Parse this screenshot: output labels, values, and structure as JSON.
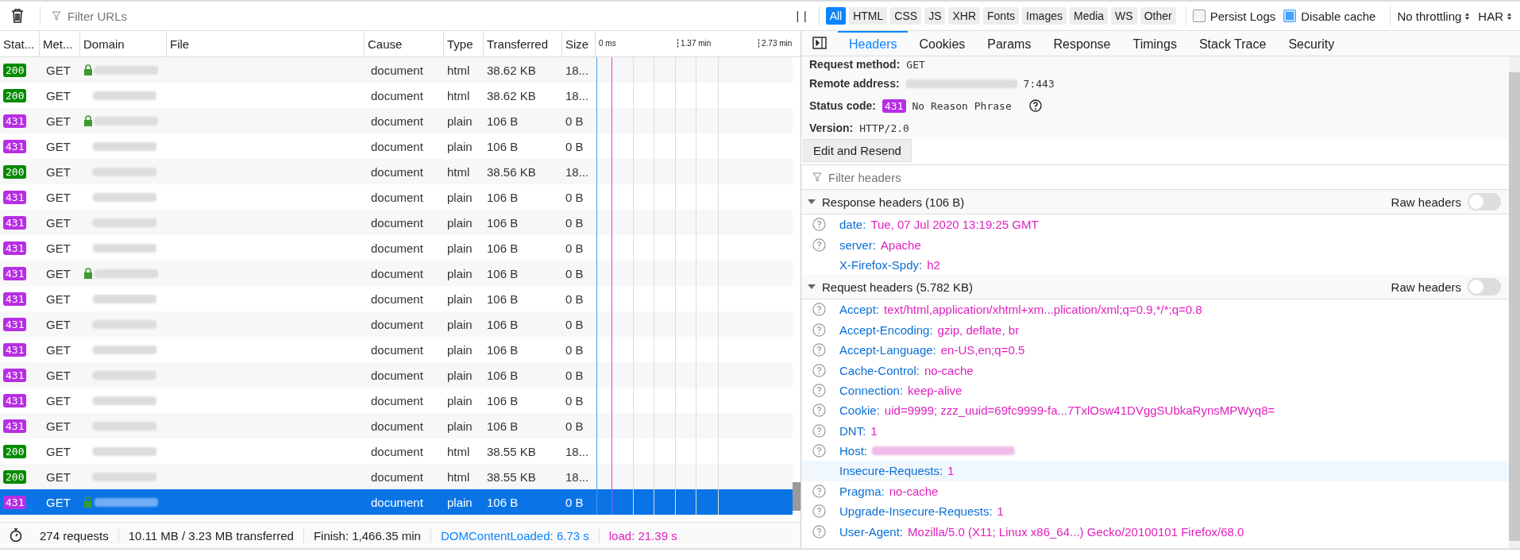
{
  "toolbar": {
    "filter_placeholder": "Filter URLs",
    "pause_icon": "| |",
    "type_filters": [
      {
        "label": "All",
        "selected": true
      },
      {
        "label": "HTML",
        "selected": false
      },
      {
        "label": "CSS",
        "selected": false
      },
      {
        "label": "JS",
        "selected": false
      },
      {
        "label": "XHR",
        "selected": false
      },
      {
        "label": "Fonts",
        "selected": false
      },
      {
        "label": "Images",
        "selected": false
      },
      {
        "label": "Media",
        "selected": false
      },
      {
        "label": "WS",
        "selected": false
      },
      {
        "label": "Other",
        "selected": false
      }
    ],
    "options": [
      {
        "label": "Persist Logs",
        "checked": false
      },
      {
        "label": "Disable cache",
        "checked": true
      }
    ],
    "throttling": "No throttling",
    "har": "HAR"
  },
  "requests": {
    "columns": [
      "Stat...",
      "Met...",
      "Domain",
      "File",
      "Cause",
      "Type",
      "Transferred",
      "Size"
    ],
    "timeline_ticks": [
      "0 ms",
      "1.37 min",
      "2.73 min"
    ],
    "rows": [
      {
        "status": "200",
        "method": "GET",
        "secure": true,
        "cause": "document",
        "type": "html",
        "transferred": "38.62 KB",
        "size": "18...",
        "selected": false
      },
      {
        "status": "200",
        "method": "GET",
        "secure": false,
        "cause": "document",
        "type": "html",
        "transferred": "38.62 KB",
        "size": "18...",
        "selected": false
      },
      {
        "status": "431",
        "method": "GET",
        "secure": true,
        "cause": "document",
        "type": "plain",
        "transferred": "106 B",
        "size": "0 B",
        "selected": false
      },
      {
        "status": "431",
        "method": "GET",
        "secure": false,
        "cause": "document",
        "type": "plain",
        "transferred": "106 B",
        "size": "0 B",
        "selected": false
      },
      {
        "status": "200",
        "method": "GET",
        "secure": false,
        "cause": "document",
        "type": "html",
        "transferred": "38.56 KB",
        "size": "18...",
        "selected": false
      },
      {
        "status": "431",
        "method": "GET",
        "secure": false,
        "cause": "document",
        "type": "plain",
        "transferred": "106 B",
        "size": "0 B",
        "selected": false
      },
      {
        "status": "431",
        "method": "GET",
        "secure": false,
        "cause": "document",
        "type": "plain",
        "transferred": "106 B",
        "size": "0 B",
        "selected": false
      },
      {
        "status": "431",
        "method": "GET",
        "secure": false,
        "cause": "document",
        "type": "plain",
        "transferred": "106 B",
        "size": "0 B",
        "selected": false
      },
      {
        "status": "431",
        "method": "GET",
        "secure": true,
        "cause": "document",
        "type": "plain",
        "transferred": "106 B",
        "size": "0 B",
        "selected": false
      },
      {
        "status": "431",
        "method": "GET",
        "secure": false,
        "cause": "document",
        "type": "plain",
        "transferred": "106 B",
        "size": "0 B",
        "selected": false
      },
      {
        "status": "431",
        "method": "GET",
        "secure": false,
        "cause": "document",
        "type": "plain",
        "transferred": "106 B",
        "size": "0 B",
        "selected": false
      },
      {
        "status": "431",
        "method": "GET",
        "secure": false,
        "cause": "document",
        "type": "plain",
        "transferred": "106 B",
        "size": "0 B",
        "selected": false
      },
      {
        "status": "431",
        "method": "GET",
        "secure": false,
        "cause": "document",
        "type": "plain",
        "transferred": "106 B",
        "size": "0 B",
        "selected": false
      },
      {
        "status": "431",
        "method": "GET",
        "secure": false,
        "cause": "document",
        "type": "plain",
        "transferred": "106 B",
        "size": "0 B",
        "selected": false
      },
      {
        "status": "431",
        "method": "GET",
        "secure": false,
        "cause": "document",
        "type": "plain",
        "transferred": "106 B",
        "size": "0 B",
        "selected": false
      },
      {
        "status": "200",
        "method": "GET",
        "secure": false,
        "cause": "document",
        "type": "html",
        "transferred": "38.55 KB",
        "size": "18...",
        "selected": false
      },
      {
        "status": "200",
        "method": "GET",
        "secure": false,
        "cause": "document",
        "type": "html",
        "transferred": "38.55 KB",
        "size": "18...",
        "selected": false
      },
      {
        "status": "431",
        "method": "GET",
        "secure": true,
        "cause": "document",
        "type": "plain",
        "transferred": "106 B",
        "size": "0 B",
        "selected": true
      }
    ]
  },
  "summary": {
    "requests": "274 requests",
    "transferred": "10.11 MB / 3.23 MB transferred",
    "finish": "Finish: 1,466.35 min",
    "dom_content_loaded": "DOMContentLoaded: 6.73 s",
    "load": "load: 21.39 s"
  },
  "details": {
    "tabs": [
      {
        "label": "Headers",
        "selected": true
      },
      {
        "label": "Cookies",
        "selected": false
      },
      {
        "label": "Params",
        "selected": false
      },
      {
        "label": "Response",
        "selected": false
      },
      {
        "label": "Timings",
        "selected": false
      },
      {
        "label": "Stack Trace",
        "selected": false
      },
      {
        "label": "Security",
        "selected": false
      }
    ],
    "request_method": {
      "label": "Request method:",
      "value": "GET"
    },
    "remote_address": {
      "label": "Remote address:",
      "value": "7:443"
    },
    "status_code": {
      "label": "Status code:",
      "code": "431",
      "phrase": "No Reason Phrase"
    },
    "version": {
      "label": "Version:",
      "value": "HTTP/2.0"
    },
    "edit_resend": "Edit and Resend",
    "filter_placeholder": "Filter headers",
    "sections": [
      {
        "title": "Response headers (106 B)",
        "expanded": true,
        "raw_label": "Raw headers",
        "raw": false,
        "headers": [
          {
            "name": "date:",
            "value": "Tue, 07 Jul 2020 13:19:25 GMT",
            "help_icon": true,
            "highlighted": false
          },
          {
            "name": "server:",
            "value": "Apache",
            "help_icon": true,
            "highlighted": false
          },
          {
            "name": "X-Firefox-Spdy:",
            "value": "h2",
            "help_icon": false,
            "highlighted": false
          }
        ]
      },
      {
        "title": "Request headers (5.782 KB)",
        "expanded": true,
        "raw_label": "Raw headers",
        "raw": false,
        "headers": [
          {
            "name": "Accept:",
            "value": "text/html,application/xhtml+xm...plication/xml;q=0.9,*/*;q=0.8",
            "help_icon": true,
            "highlighted": false
          },
          {
            "name": "Accept-Encoding:",
            "value": "gzip, deflate, br",
            "help_icon": true,
            "highlighted": false
          },
          {
            "name": "Accept-Language:",
            "value": "en-US,en;q=0.5",
            "help_icon": true,
            "highlighted": false
          },
          {
            "name": "Cache-Control:",
            "value": "no-cache",
            "help_icon": true,
            "highlighted": false
          },
          {
            "name": "Connection:",
            "value": "keep-alive",
            "help_icon": true,
            "highlighted": false
          },
          {
            "name": "Cookie:",
            "value": "uid=9999; zzz_uuid=69fc9999-fa...7TxlOsw41DVggSUbkaRynsMPWyq8=",
            "help_icon": true,
            "highlighted": false
          },
          {
            "name": "DNT:",
            "value": "1",
            "help_icon": true,
            "highlighted": false
          },
          {
            "name": "Host:",
            "help_icon": true,
            "highlighted": false,
            "redacted": true
          },
          {
            "name": "Insecure-Requests:",
            "value": "1",
            "help_icon": false,
            "highlighted": true
          },
          {
            "name": "Pragma:",
            "value": "no-cache",
            "help_icon": true,
            "highlighted": false
          },
          {
            "name": "Upgrade-Insecure-Requests:",
            "value": "1",
            "help_icon": true,
            "highlighted": false
          },
          {
            "name": "User-Agent:",
            "value": "Mozilla/5.0 (X11; Linux x86_64...) Gecko/20100101 Firefox/68.0",
            "help_icon": true,
            "highlighted": false
          }
        ]
      }
    ]
  }
}
